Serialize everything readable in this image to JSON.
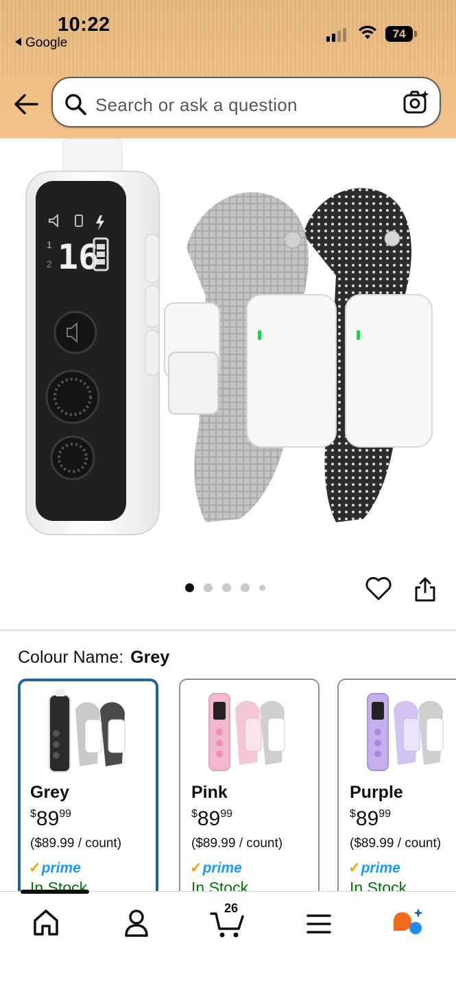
{
  "status_bar": {
    "time": "10:22",
    "back_app": "Google",
    "battery": "74"
  },
  "search": {
    "placeholder": "Search or ask a question"
  },
  "gallery": {
    "image_count": 5,
    "active_index": 0
  },
  "colour_selector": {
    "label": "Colour Name:",
    "selected": "Grey",
    "options": [
      {
        "name": "Grey",
        "price_symbol": "$",
        "price_whole": "89",
        "price_fraction": "99",
        "unit_price": "($89.99 / count)",
        "prime": "prime",
        "stock": "In Stock",
        "accent": "#2b2b2b"
      },
      {
        "name": "Pink",
        "price_symbol": "$",
        "price_whole": "89",
        "price_fraction": "99",
        "unit_price": "($89.99 / count)",
        "prime": "prime",
        "stock": "In Stock",
        "accent": "#f2b8cf"
      },
      {
        "name": "Purple",
        "price_symbol": "$",
        "price_whole": "89",
        "price_fraction": "99",
        "unit_price": "($89.99 / count)",
        "prime": "prime",
        "stock": "In Stock",
        "accent": "#c5b0ea"
      }
    ]
  },
  "bottom_nav": {
    "cart_count": "26",
    "items": [
      "home-icon",
      "account-icon",
      "cart-icon",
      "menu-icon",
      "ai-assistant-icon"
    ]
  },
  "colors": {
    "header": "#f3c38b",
    "selected_border": "#2162a1",
    "prime_blue": "#1a98ff",
    "prime_check": "#ff9900",
    "in_stock": "#007600"
  }
}
